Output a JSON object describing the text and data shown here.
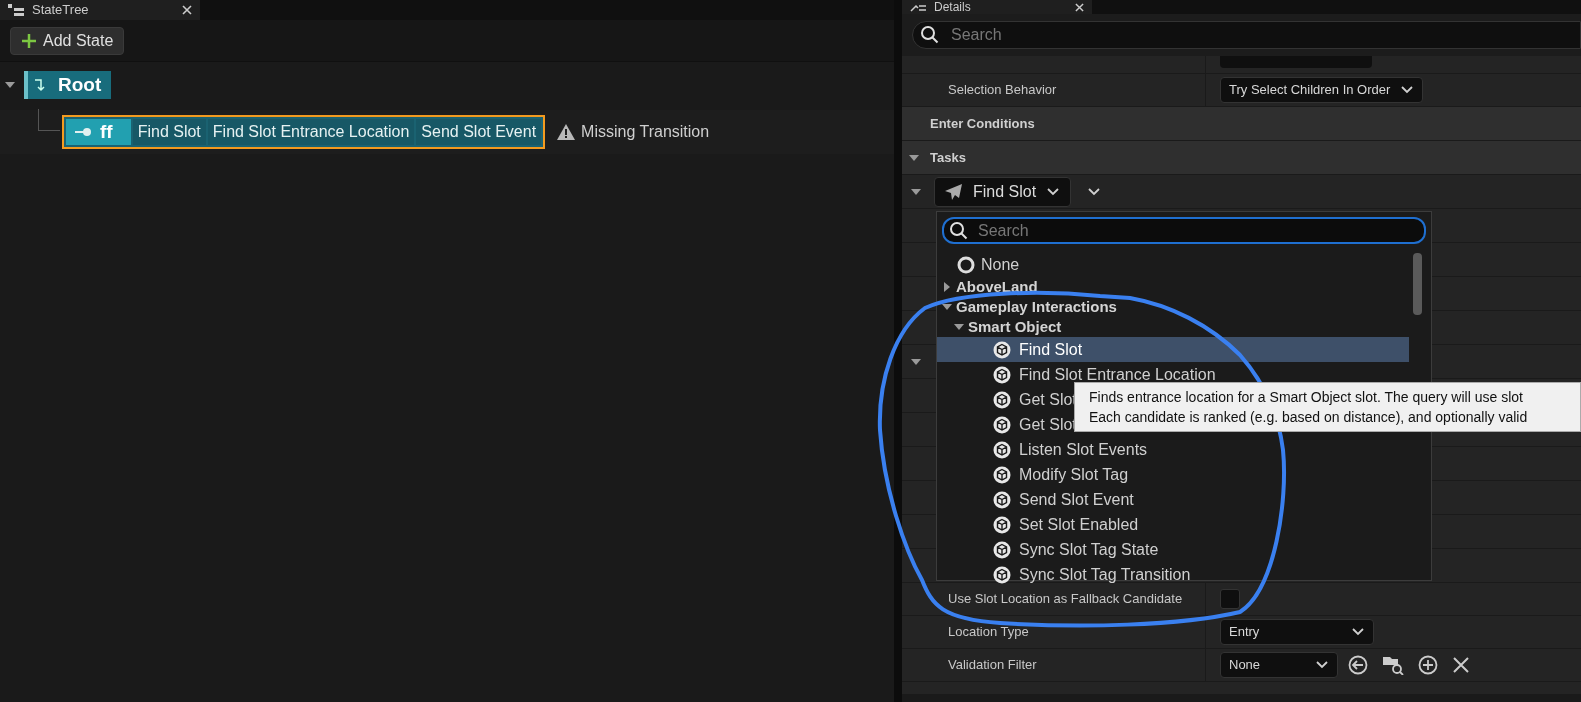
{
  "statetree_panel": {
    "tab_title": "StateTree",
    "add_state_button": "Add State",
    "tree": [
      {
        "name": "Root",
        "expanded": true,
        "children": [
          {
            "name": "ff",
            "selected": true,
            "tasks": [
              "Find Slot",
              "Find Slot Entrance Location",
              "Send Slot Event"
            ],
            "warning": "Missing Transition"
          }
        ]
      }
    ]
  },
  "details_panel": {
    "tab_title": "Details",
    "search": {
      "placeholder": "Search"
    },
    "properties": [
      {
        "kind": "dropdown",
        "label": "Selection Behavior",
        "value": "Try Select Children In Order"
      },
      {
        "kind": "section",
        "label": "Enter Conditions"
      },
      {
        "kind": "section",
        "label": "Tasks",
        "expanded": true
      },
      {
        "kind": "task",
        "value": "Find Slot",
        "expanded": true
      },
      {
        "kind": "checkbox",
        "label": "Use Slot Location as Fallback Candidate",
        "checked": false
      },
      {
        "kind": "dropdown",
        "label": "Location Type",
        "value": "Entry"
      },
      {
        "kind": "asset",
        "label": "Validation Filter",
        "value": "None"
      }
    ]
  },
  "class_picker": {
    "search": {
      "placeholder": "Search"
    },
    "items": [
      {
        "kind": "none",
        "label": "None"
      },
      {
        "kind": "category",
        "label": "AboveLand",
        "expanded": false
      },
      {
        "kind": "category",
        "label": "Gameplay Interactions",
        "expanded": true,
        "children": [
          {
            "kind": "category",
            "label": "Smart Object",
            "expanded": true,
            "children": [
              {
                "kind": "class",
                "label": "Find Slot",
                "selected": true
              },
              {
                "kind": "class",
                "label": "Find Slot Entrance Location",
                "selected": false
              },
              {
                "kind": "class",
                "label": "Get Slot",
                "selected": false
              },
              {
                "kind": "class",
                "label": "Get Slot",
                "selected": false
              },
              {
                "kind": "class",
                "label": "Listen Slot Events",
                "selected": false
              },
              {
                "kind": "class",
                "label": "Modify Slot Tag",
                "selected": false
              },
              {
                "kind": "class",
                "label": "Send Slot Event",
                "selected": false
              },
              {
                "kind": "class",
                "label": "Set Slot Enabled",
                "selected": false
              },
              {
                "kind": "class",
                "label": "Sync Slot Tag State",
                "selected": false
              },
              {
                "kind": "class",
                "label": "Sync Slot Tag Transition",
                "selected": false
              }
            ]
          }
        ]
      }
    ]
  },
  "tooltip": {
    "lines": [
      "Finds entrance location for a Smart Object slot. The query will use slot",
      "Each candidate is ranked (e.g. based on distance), and optionally valid"
    ]
  }
}
